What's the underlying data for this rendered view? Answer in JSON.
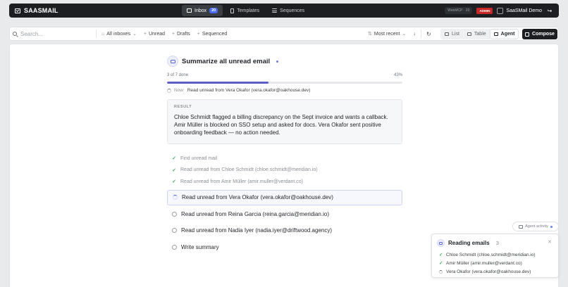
{
  "brand": {
    "name": "SAASMAIL"
  },
  "nav": {
    "tabs": [
      {
        "label": "Inbox",
        "count": "20"
      },
      {
        "label": "Templates"
      },
      {
        "label": "Sequences"
      }
    ]
  },
  "topright": {
    "webmcp": "WebMCP · 20",
    "role_badge": "ADMIN",
    "user_name": "SaaSMail Demo"
  },
  "toolbar": {
    "search_placeholder": "Search...",
    "filters": [
      "All inboxes",
      "Unread",
      "Drafts",
      "Sequenced"
    ],
    "sort": "Most recent",
    "views": [
      "List",
      "Table",
      "Agent"
    ],
    "active_view": "Agent",
    "compose_label": "Compose"
  },
  "agent": {
    "title": "Summarize all unread email",
    "progress_text": "3 of 7 done",
    "progress_pct_label": "43%",
    "progress_fraction": 0.43,
    "now_prefix": "Now:",
    "now_text": "Read unread from Vera Okafor (vera.okafor@oakhouse.dev)",
    "result_label": "RESULT",
    "result_text": "Chloe Schmidt flagged a billing discrepancy on the Sept invoice and wants a callback. Amir Müller is blocked on SSO setup and asked for docs. Vera Okafor sent positive onboarding feedback — no action needed.",
    "steps": [
      {
        "label": "Find unread mail",
        "state": "done"
      },
      {
        "label": "Read unread from Chloe Schmidt (chloe.schmidt@meridian.io)",
        "state": "done"
      },
      {
        "label": "Read unread from Amir Müller (amir.muller@verdant.co)",
        "state": "done"
      },
      {
        "label": "Read unread from Vera Okafor (vera.okafor@oakhouse.dev)",
        "state": "current"
      },
      {
        "label": "Read unread from Reina Garcia (reina.garcia@meridian.io)",
        "state": "pending"
      },
      {
        "label": "Read unread from Nadia Iyer (nadia.iyer@driftwood.agency)",
        "state": "pending"
      },
      {
        "label": "Write summary",
        "state": "pending"
      }
    ]
  },
  "activity": {
    "button_label": "Agent activity",
    "title": "Reading emails",
    "count": "3",
    "items": [
      {
        "label": "Chloe Schmidt (chloe.schmidt@meridian.io)",
        "state": "done"
      },
      {
        "label": "Amir Müller (amir.muller@verdant.co)",
        "state": "done"
      },
      {
        "label": "Vera Okafor (vera.okafor@oakhouse.dev)",
        "state": "loading"
      }
    ]
  },
  "colors": {
    "accent": "#5b5fc7",
    "success": "#3fae5a",
    "topbar": "#1c1e21",
    "admin_badge": "#c62828"
  }
}
